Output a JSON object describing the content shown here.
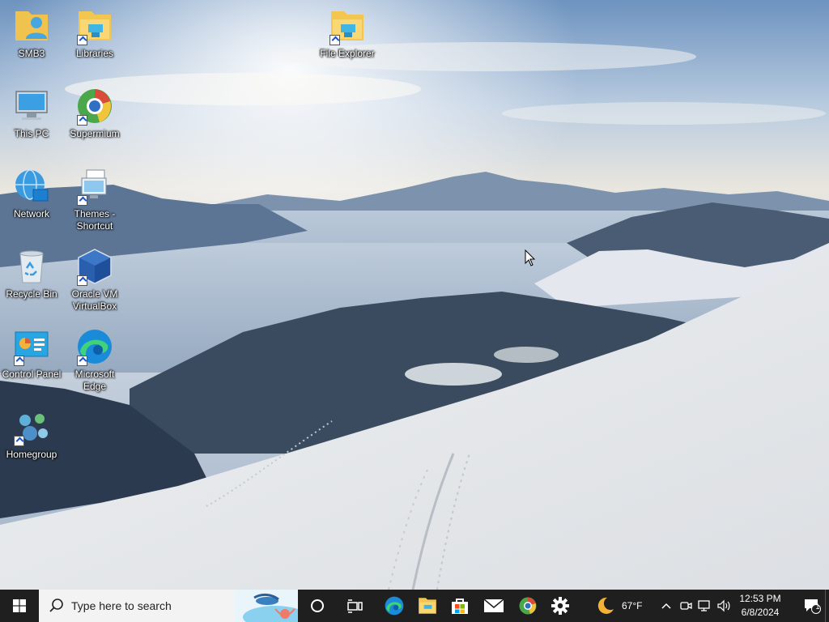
{
  "desktop": {
    "icons": [
      {
        "label": "SMB3"
      },
      {
        "label": "Libraries"
      },
      {
        "label": "File Explorer"
      },
      {
        "label": "This PC"
      },
      {
        "label": "Supermium"
      },
      {
        "label": "Network"
      },
      {
        "label": "Themes - Shortcut"
      },
      {
        "label": "Recycle Bin"
      },
      {
        "label": "Oracle VM VirtualBox"
      },
      {
        "label": "Control Panel"
      },
      {
        "label": "Microsoft Edge"
      },
      {
        "label": "Homegroup"
      }
    ]
  },
  "taskbar": {
    "start_icon": "windows-logo-icon",
    "search": {
      "placeholder": "Type here to search"
    },
    "pinned": [
      {
        "name": "cortana-icon"
      },
      {
        "name": "task-view-icon"
      },
      {
        "name": "edge-icon"
      },
      {
        "name": "file-explorer-icon"
      },
      {
        "name": "store-icon"
      },
      {
        "name": "mail-icon"
      },
      {
        "name": "supermium-icon"
      },
      {
        "name": "settings-icon"
      }
    ],
    "weather": {
      "temp": "67°F",
      "icon": "moon-icon"
    },
    "tray": {
      "icons": [
        "chevron-up-icon",
        "meet-now-icon",
        "network-icon",
        "volume-icon"
      ],
      "time": "12:53 PM",
      "date": "6/8/2024",
      "notification_count": "1"
    }
  }
}
